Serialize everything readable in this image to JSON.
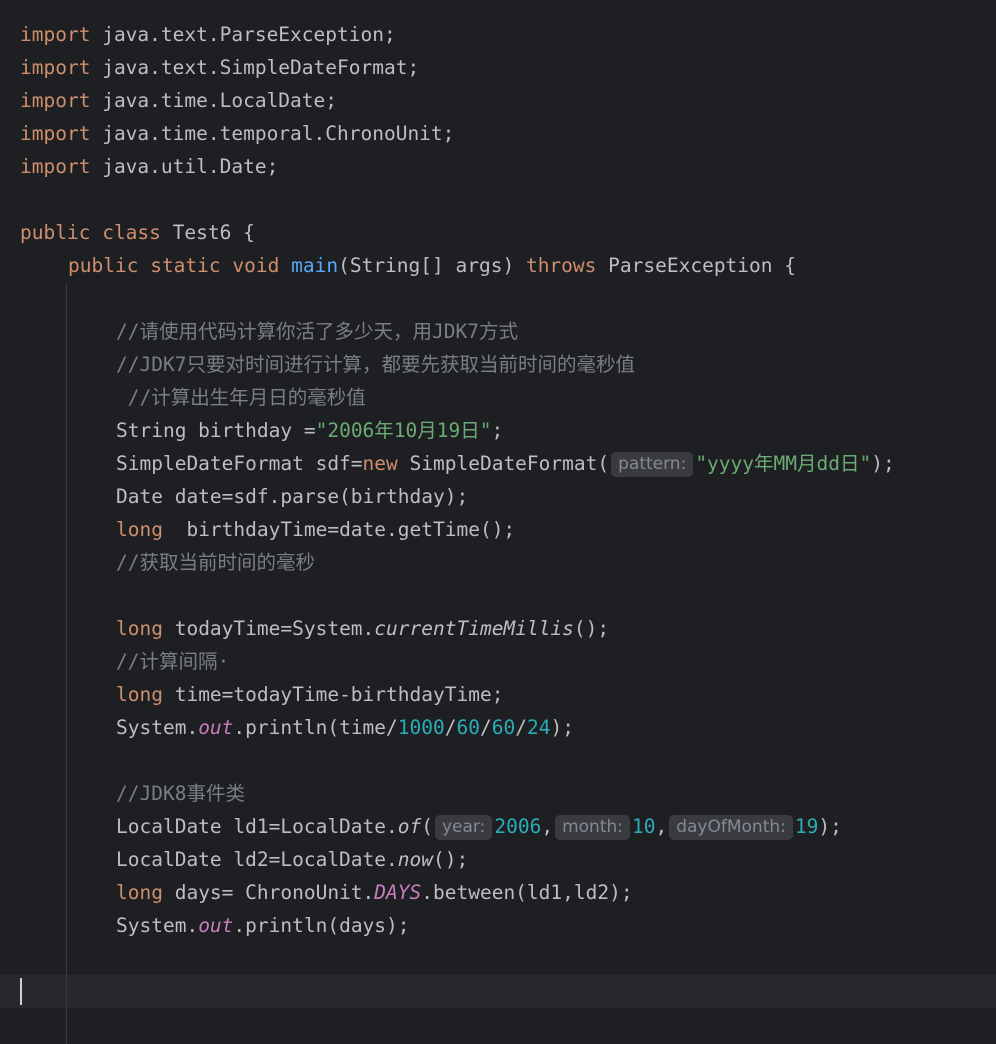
{
  "editor": {
    "imports": [
      {
        "kw": "import",
        "target": "java.text.ParseException;"
      },
      {
        "kw": "import",
        "target": "java.text.SimpleDateFormat;"
      },
      {
        "kw": "import",
        "target": "java.time.LocalDate;"
      },
      {
        "kw": "import",
        "target": "java.time.temporal.ChronoUnit;"
      },
      {
        "kw": "import",
        "target": "java.util.Date;"
      }
    ],
    "class_decl": {
      "kw_public": "public",
      "kw_class": "class",
      "name": "Test6 {"
    },
    "main_decl": {
      "kw_public": "public",
      "kw_static": "static",
      "kw_void": "void",
      "method": "main",
      "params": "(String[] args)",
      "kw_throws": "throws",
      "exception": "ParseException {"
    },
    "comment_1": "//请使用代码计算你活了多少天，用JDK7方式",
    "comment_2": "//JDK7只要对时间进行计算，都要先获取当前时间的毫秒值",
    "comment_3": " //计算出生年月日的毫秒值",
    "birthday_line": {
      "decl": "String birthday =",
      "value": "\"2006年10月19日\"",
      "end": ";"
    },
    "sdf_line": {
      "decl": "SimpleDateFormat sdf=",
      "kw_new": "new",
      "ctor": " SimpleDateFormat(",
      "hint": "pattern:",
      "value": "\"yyyy年MM月dd日\"",
      "end": ");"
    },
    "date_line": "Date date=sdf.parse(birthday);",
    "birthday_time_line": {
      "kw_long": "long",
      "rest": "  birthdayTime=date.getTime();"
    },
    "comment_4": "//获取当前时间的毫秒",
    "today_line": {
      "kw_long": "long",
      "decl": " todayTime=System.",
      "method": "currentTimeMillis",
      "end": "();"
    },
    "comment_5": "//计算间隔·",
    "time_line": {
      "kw_long": "long",
      "rest": " time=todayTime-birthdayTime;"
    },
    "println_1": {
      "obj": "System.",
      "field": "out",
      "call": ".println(time/",
      "n1": "1000",
      "n2": "60",
      "n3": "60",
      "n4": "24",
      "sep": "/",
      "end": ");"
    },
    "comment_6": "//JDK8事件类",
    "ld1_line": {
      "decl": "LocalDate ld1=LocalDate.",
      "method": "of",
      "open": "(",
      "hint_year": "year:",
      "year": "2006",
      "comma": ",",
      "hint_month": "month:",
      "month": "10",
      "hint_day": "dayOfMonth:",
      "day": "19",
      "end": ");"
    },
    "ld2_line": {
      "decl": "LocalDate ld2=LocalDate.",
      "method": "now",
      "end": "();"
    },
    "days_line": {
      "kw_long": "long",
      "decl": " days= ChronoUnit.",
      "field": "DAYS",
      "end": ".between(ld1,ld2);"
    },
    "println_2": {
      "obj": "System.",
      "field": "out",
      "end": ".println(days);"
    }
  }
}
